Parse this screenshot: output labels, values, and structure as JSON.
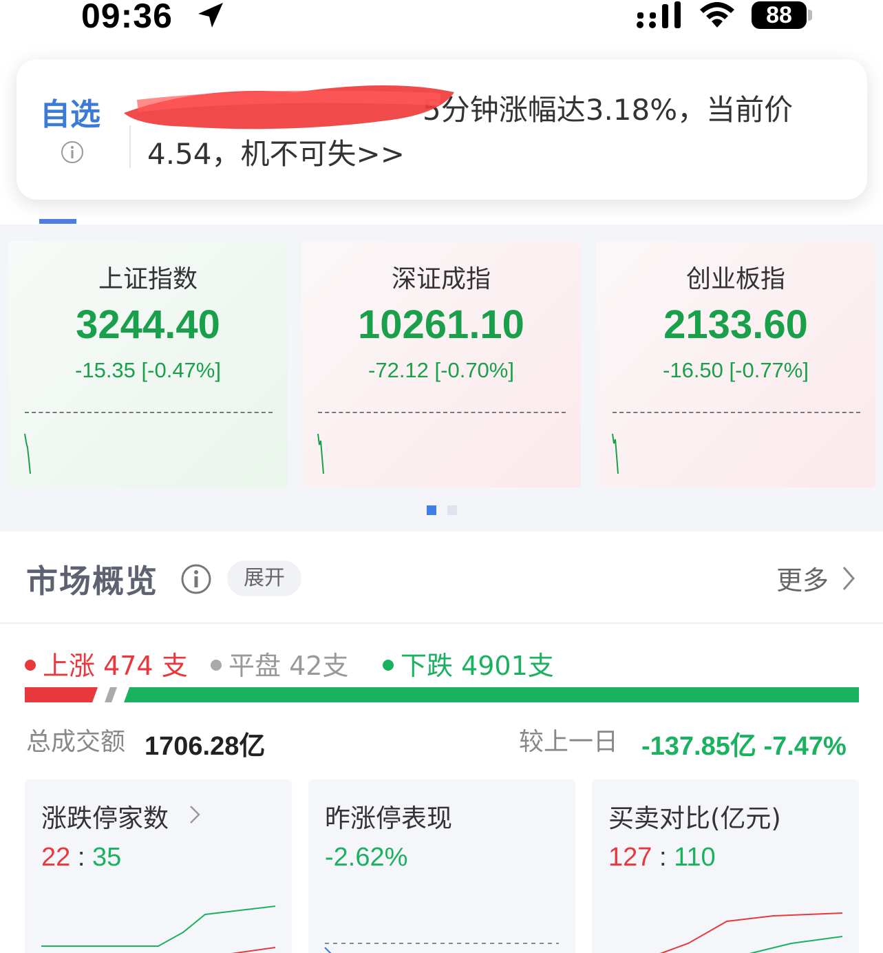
{
  "status_bar": {
    "time": "09:36",
    "battery": "88",
    "icons": [
      "location-arrow-icon",
      "signal-icon",
      "wifi-icon",
      "battery-icon"
    ]
  },
  "notification": {
    "tag": "自选",
    "message": "5分钟涨幅达3.18%，当前价4.54，机不可失>>",
    "icons": [
      "info-icon"
    ]
  },
  "indices": [
    {
      "name": "上证指数",
      "value": "3244.40",
      "change": "-15.35 [-0.47%]",
      "trend": "down"
    },
    {
      "name": "深证成指",
      "value": "10261.10",
      "change": "-72.12 [-0.70%]",
      "trend": "down"
    },
    {
      "name": "创业板指",
      "value": "2133.60",
      "change": "-16.50 [-0.77%]",
      "trend": "down"
    }
  ],
  "pager": {
    "pages": 2,
    "active": 1
  },
  "market_overview": {
    "title": "市场概览",
    "expand_label": "展开",
    "more_label": "更多",
    "breadth": {
      "up_label": "上涨 474 支",
      "flat_label": "平盘 42支",
      "down_label": "下跌 4901支",
      "up": 474,
      "flat": 42,
      "down": 4901
    },
    "turnover_label": "总成交额",
    "turnover_value": "1706.28亿",
    "compare_label": "较上一日",
    "compare_value": "-137.85亿 -7.47%",
    "cards": [
      {
        "title": "涨跌停家数",
        "value_a": "22",
        "sep": ":",
        "value_b": "35"
      },
      {
        "title": "昨涨停表现",
        "value": "-2.62%"
      },
      {
        "title": "买卖对比(亿元)",
        "value_a": "127",
        "sep": ":",
        "value_b": "110"
      }
    ]
  },
  "colors": {
    "up": "#e8383d",
    "down": "#1ab15f",
    "accent": "#3b7ad8"
  }
}
